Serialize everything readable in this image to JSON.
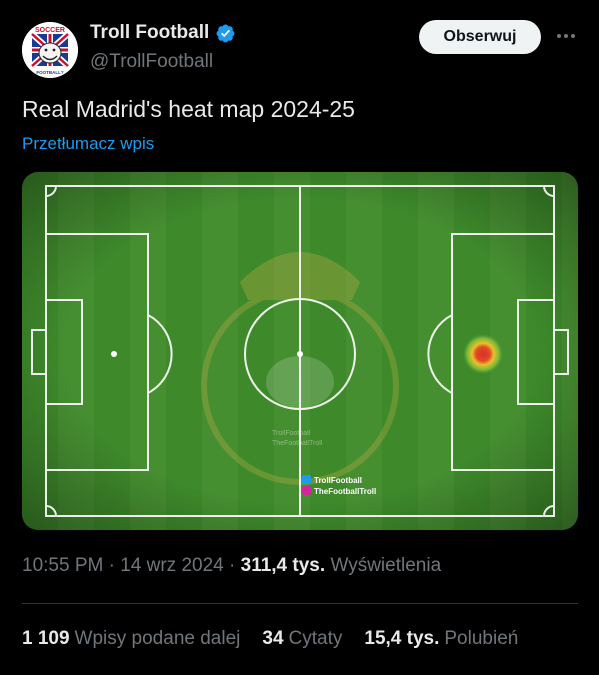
{
  "author": {
    "name": "Troll Football",
    "handle": "@TrollFootball",
    "avatar_top_text": "SOCCER",
    "avatar_bottom_text": "FOOTBALL?"
  },
  "follow_label": "Obserwuj",
  "tweet": {
    "text": "Real Madrid's heat map 2024-25",
    "translate_label": "Przetłumacz wpis"
  },
  "media": {
    "watermark_twitter": "TrollFootball",
    "watermark_instagram": "TheFootballTroll",
    "faint_watermark_1": "TrollFootball",
    "faint_watermark_2": "TheFootballTroll"
  },
  "meta": {
    "time": "10:55 PM",
    "date": "14 wrz 2024",
    "views_count": "311,4 tys.",
    "views_label": "Wyświetlenia"
  },
  "stats": {
    "reposts_count": "1 109",
    "reposts_label": "Wpisy podane dalej",
    "quotes_count": "34",
    "quotes_label": "Cytaty",
    "likes_count": "15,4 tys.",
    "likes_label": "Polubień"
  },
  "colors": {
    "accent": "#1d9bf0",
    "pitch": "#3f8a2a",
    "heat_core": "#d9302a"
  }
}
